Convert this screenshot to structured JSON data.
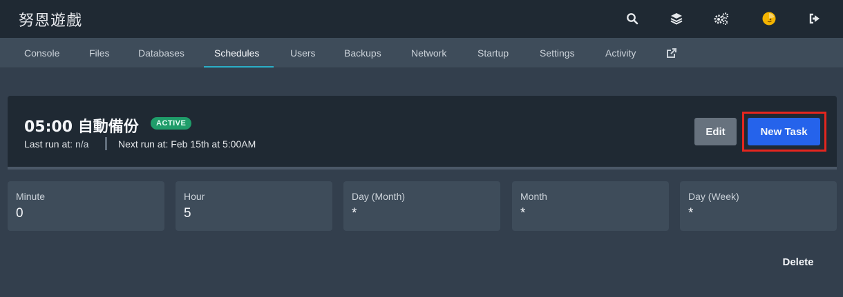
{
  "app": {
    "title": "努恩遊戲"
  },
  "header_icons": [
    "search-icon",
    "layers-icon",
    "cogs-icon",
    "avatar",
    "logout-icon"
  ],
  "tabs": [
    {
      "label": "Console"
    },
    {
      "label": "Files"
    },
    {
      "label": "Databases"
    },
    {
      "label": "Schedules",
      "active": true
    },
    {
      "label": "Users"
    },
    {
      "label": "Backups"
    },
    {
      "label": "Network"
    },
    {
      "label": "Startup"
    },
    {
      "label": "Settings"
    },
    {
      "label": "Activity"
    }
  ],
  "schedule": {
    "title": "05:00 自動備份",
    "status": "ACTIVE",
    "last_run_label": "Last run at:",
    "last_run_value": "n/a",
    "next_run_label": "Next run at:",
    "next_run_value": "Feb 15th at 5:00AM"
  },
  "buttons": {
    "edit": "Edit",
    "new_task": "New Task",
    "delete": "Delete"
  },
  "cron": [
    {
      "label": "Minute",
      "value": "0"
    },
    {
      "label": "Hour",
      "value": "5"
    },
    {
      "label": "Day (Month)",
      "value": "*"
    },
    {
      "label": "Month",
      "value": "*"
    },
    {
      "label": "Day (Week)",
      "value": "*"
    }
  ],
  "colors": {
    "topbar": "#1f2933",
    "subnav": "#3e4c5a",
    "accent_tab": "#2bb0c9",
    "badge": "#1f9d6a",
    "primary_button": "#2563eb",
    "secondary_button": "#67727e",
    "highlight_box": "#e5261e"
  }
}
